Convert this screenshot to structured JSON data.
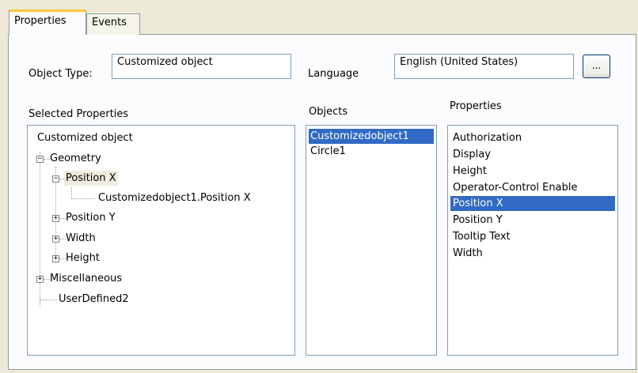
{
  "tabs": [
    {
      "label": "Properties",
      "active": true
    },
    {
      "label": "Events",
      "active": false
    }
  ],
  "object_type": {
    "label": "Object Type:",
    "value": "Customized object"
  },
  "language": {
    "label": "Language",
    "value": "English (United States)",
    "browse_button": "..."
  },
  "selected_properties": {
    "label": "Selected Properties",
    "tree": {
      "root": "Customized object",
      "geometry": "Geometry",
      "position_x": "Position X",
      "position_x_child": "Customizedobject1.Position X",
      "position_y": "Position Y",
      "width": "Width",
      "height": "Height",
      "miscellaneous": "Miscellaneous",
      "userdefined2": "UserDefined2"
    }
  },
  "objects": {
    "label": "Objects",
    "items": [
      "Customizedobject1",
      "Circle1"
    ],
    "selected": "Customizedobject1"
  },
  "properties": {
    "label": "Properties",
    "items": [
      "Authorization",
      "Display",
      "Height",
      "Operator-Control Enable",
      "Position X",
      "Position Y",
      "Tooltip Text",
      "Width"
    ],
    "selected": "Position X"
  },
  "colors": {
    "selection": "#316ac5",
    "tab_highlight": "#ffc83c",
    "field_border": "#7f9db9"
  }
}
